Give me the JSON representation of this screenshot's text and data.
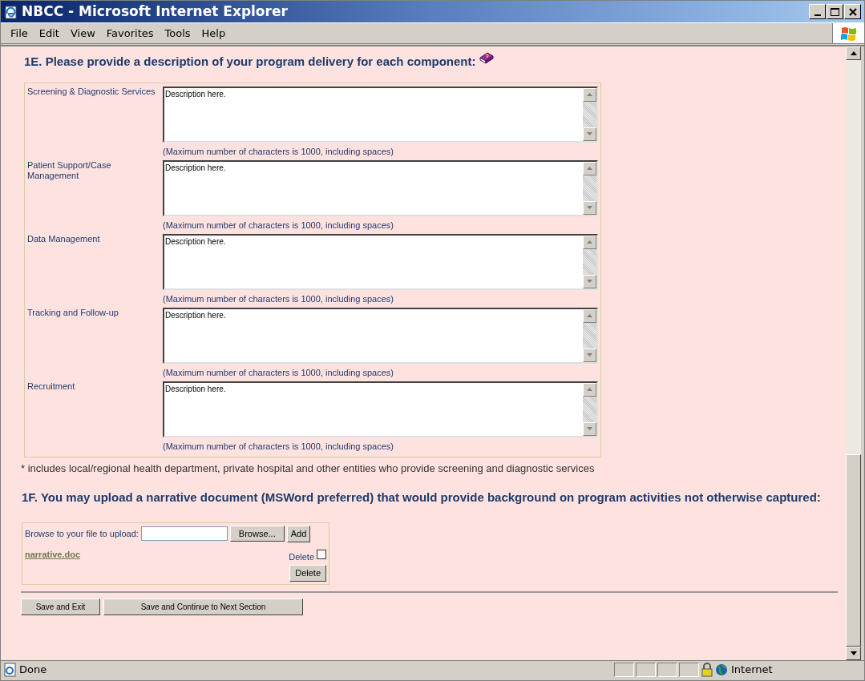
{
  "window": {
    "title": "NBCC - Microsoft Internet Explorer"
  },
  "menu": [
    "File",
    "Edit",
    "View",
    "Favorites",
    "Tools",
    "Help"
  ],
  "section_1e": {
    "heading": "1E. Please provide a description of your program delivery for each component:",
    "components": [
      {
        "label": "Screening & Diagnostic Services",
        "value": "Description here.",
        "hint": "(Maximum number of characters is 1000, including spaces)"
      },
      {
        "label": "Patient Support/Case Management",
        "value": "Description here.",
        "hint": "(Maximum number of characters is 1000, including spaces)"
      },
      {
        "label": "Data Management",
        "value": "Description here.",
        "hint": "(Maximum number of characters is 1000, including spaces)"
      },
      {
        "label": "Tracking and Follow-up",
        "value": "Description here.",
        "hint": "(Maximum number of characters is 1000, including spaces)"
      },
      {
        "label": "Recruitment",
        "value": "Description here.",
        "hint": "(Maximum number of characters is 1000, including spaces)"
      }
    ],
    "footnote": "* includes local/regional health department, private hospital and other entities who provide screening and diagnostic services"
  },
  "section_1f": {
    "heading": "1F. You may upload a narrative document (MSWord preferred) that would provide background on program activities not otherwise captured:",
    "upload_label": "Browse to your file to upload:",
    "browse_button": "Browse...",
    "add_button": "Add",
    "file_link": "narrative.doc",
    "delete_label": "Delete",
    "delete_checked": false,
    "delete_button": "Delete"
  },
  "buttons": [
    "Save and Exit",
    "Save and Continue to Next Section"
  ],
  "status_bar": {
    "text": "Done",
    "zone": "Internet"
  }
}
